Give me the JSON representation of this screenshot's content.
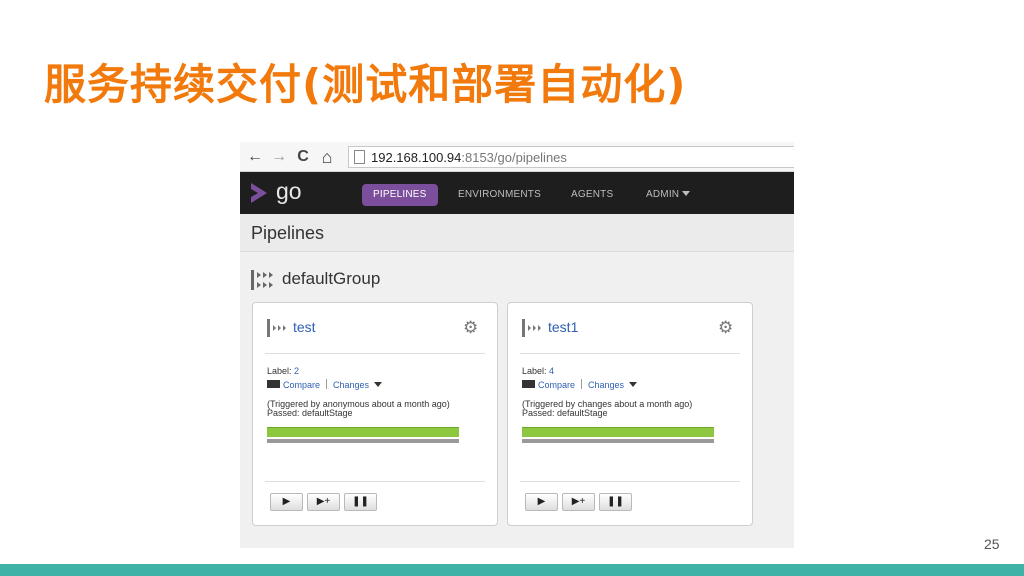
{
  "slide": {
    "title": "服务持续交付(测试和部署自动化)",
    "page_number": "25",
    "accent_color": "#f27a0c",
    "bar_color": "#3fb2a6"
  },
  "browser": {
    "back_icon": "←",
    "forward_icon": "→",
    "reload_icon": "C",
    "home_icon": "⌂",
    "url_host": "192.168.100.94",
    "url_rest": ":8153/go/pipelines"
  },
  "app": {
    "logo_text": "go",
    "nav": {
      "pipelines": "PIPELINES",
      "environments": "ENVIRONMENTS",
      "agents": "AGENTS",
      "admin": "ADMIN"
    },
    "page_title": "Pipelines",
    "group_name": "defaultGroup",
    "brand_color": "#7c4f9d"
  },
  "pipelines": [
    {
      "name": "test",
      "label_prefix": "Label: ",
      "label": "2",
      "compare": "Compare",
      "changes": "Changes",
      "triggered": "(Triggered by anonymous about a month ago)",
      "passed": "Passed: defaultStage",
      "status_color": "#8dc63f"
    },
    {
      "name": "test1",
      "label_prefix": "Label: ",
      "label": "4",
      "compare": "Compare",
      "changes": "Changes",
      "triggered": "(Triggered by changes about a month ago)",
      "passed": "Passed: defaultStage",
      "status_color": "#8dc63f"
    }
  ],
  "controls": {
    "play": "▶",
    "play_with_options": "▶+",
    "pause": "❚❚"
  }
}
